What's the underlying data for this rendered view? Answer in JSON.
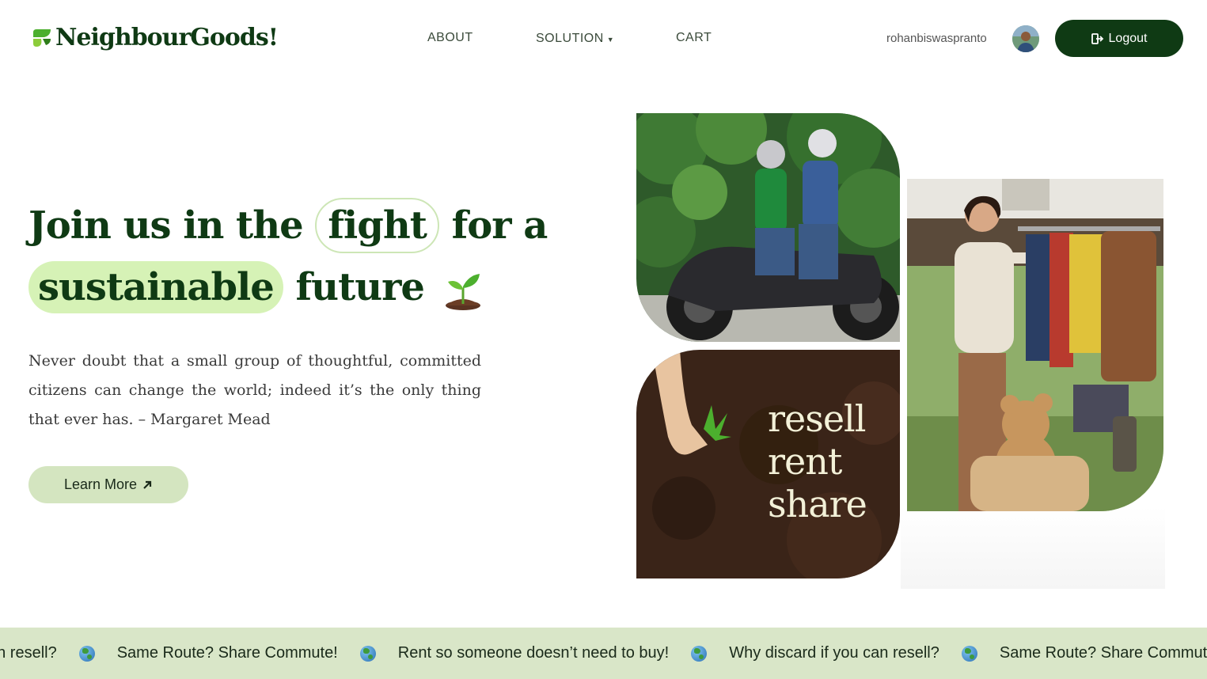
{
  "brand": {
    "name": "NeighbourGoods!"
  },
  "nav": {
    "about": "ABOUT",
    "solution": "SOLUTION",
    "cart": "CART"
  },
  "user": {
    "username": "rohanbiswaspranto",
    "logout_label": "Logout"
  },
  "hero": {
    "headline_part1": "Join us in the",
    "headline_highlight1": "fight",
    "headline_part2": "for a",
    "headline_highlight2": "sustainable",
    "headline_part3": "future",
    "quote": "Never doubt that a small group of thoughtful, committed citizens can change the world; indeed it’s the only thing that ever has. – Margaret Mead",
    "cta_label": "Learn More"
  },
  "image_overlay": {
    "line1": "resell",
    "line2": "rent",
    "line3": "share"
  },
  "marquee": {
    "items": [
      "Why discard if you can resell?",
      "Same Route? Share Commute!",
      "Rent so someone doesn’t need to buy!",
      "Why discard if you can resell?",
      "Same Route? Share Commute!"
    ],
    "visible_first": "an resell?"
  },
  "colors": {
    "brand_dark": "#0f3a14",
    "highlight_green": "#d6f2b6",
    "cta_bg": "#d4e5c0",
    "marquee_bg": "#d9e6c8"
  },
  "icons": {
    "logout": "logout-icon",
    "learn_more": "arrow-up-right-icon",
    "separator": "globe-icon",
    "sprout": "seedling-icon"
  }
}
